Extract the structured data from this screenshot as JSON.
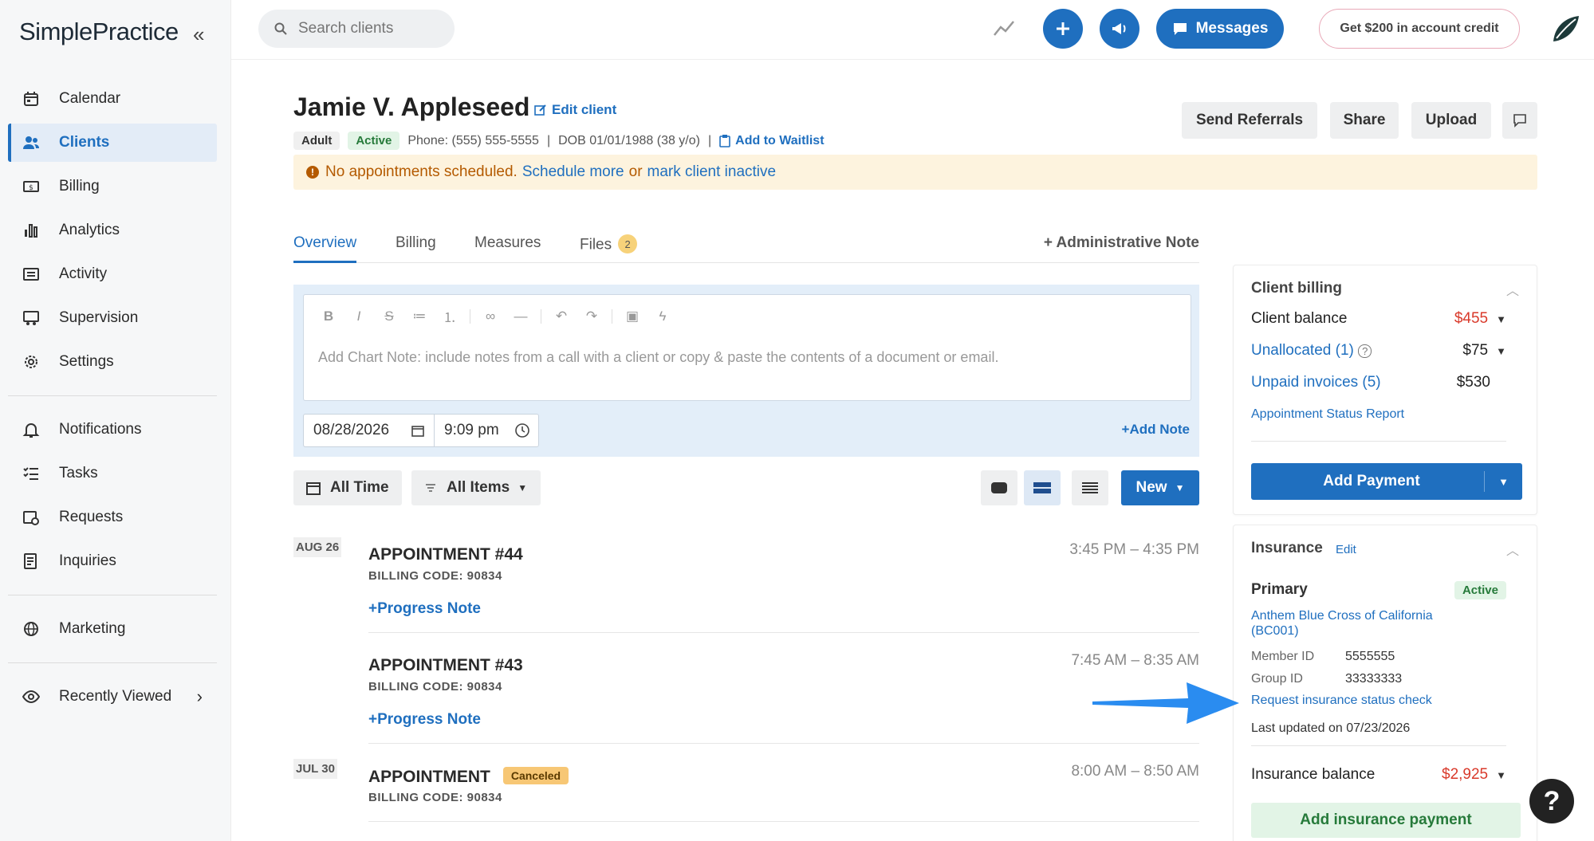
{
  "sidebar": {
    "logo": "SimplePractice",
    "collapse_glyph": "«",
    "items": [
      {
        "label": "Calendar",
        "icon": "calendar-icon"
      },
      {
        "label": "Clients",
        "icon": "users-icon",
        "active": true
      },
      {
        "label": "Billing",
        "icon": "billing-icon"
      },
      {
        "label": "Analytics",
        "icon": "analytics-icon"
      },
      {
        "label": "Activity",
        "icon": "activity-icon"
      },
      {
        "label": "Supervision",
        "icon": "supervision-icon"
      },
      {
        "label": "Settings",
        "icon": "gear-icon"
      }
    ],
    "items2": [
      {
        "label": "Notifications",
        "icon": "bell-icon"
      },
      {
        "label": "Tasks",
        "icon": "tasks-icon"
      },
      {
        "label": "Requests",
        "icon": "requests-icon"
      },
      {
        "label": "Inquiries",
        "icon": "inquiries-icon"
      }
    ],
    "marketing": "Marketing",
    "recently_viewed": "Recently Viewed"
  },
  "topbar": {
    "search_placeholder": "Search clients",
    "messages_label": "Messages",
    "credit_label": "Get $200 in account credit"
  },
  "client": {
    "name": "Jamie V. Appleseed",
    "edit_label": "Edit client",
    "tag_adult": "Adult",
    "tag_active": "Active",
    "phone": "Phone: (555) 555-5555",
    "dob": "DOB 01/01/1988 (38 y/o)",
    "waitlist_label": "Add to Waitlist",
    "separator": "|"
  },
  "header_buttons": {
    "send_referrals": "Send Referrals",
    "share": "Share",
    "upload": "Upload"
  },
  "banner": {
    "text": "No appointments scheduled.",
    "schedule_link": "Schedule more",
    "or": "or",
    "inactive_link": "mark client inactive"
  },
  "tabs": [
    {
      "label": "Overview",
      "active": true
    },
    {
      "label": "Billing"
    },
    {
      "label": "Measures"
    },
    {
      "label": "Files",
      "badge": "2"
    }
  ],
  "admin_note": "Administrative Note",
  "editor": {
    "placeholder": "Add Chart Note: include notes from a call with a client or copy & paste the contents of a document or email.",
    "date": "08/28/2026",
    "time": "9:09 pm",
    "add_note": "Add Note"
  },
  "filters": {
    "all_time": "All Time",
    "all_items": "All Items",
    "new": "New"
  },
  "appointments": [
    {
      "date": "AUG 26",
      "title": "APPOINTMENT #44",
      "code": "BILLING CODE: 90834",
      "time": "3:45 PM – 4:35 PM",
      "action": "Progress Note"
    },
    {
      "date": "",
      "title": "APPOINTMENT #43",
      "code": "BILLING CODE: 90834",
      "time": "7:45 AM – 8:35 AM",
      "action": "Progress Note"
    },
    {
      "date": "JUL 30",
      "title": "APPOINTMENT",
      "status": "Canceled",
      "code": "BILLING CODE: 90834",
      "time": "8:00 AM – 8:50 AM"
    }
  ],
  "client_billing": {
    "title": "Client billing",
    "balance_label": "Client balance",
    "balance_value": "$455",
    "unallocated_label": "Unallocated (1)",
    "unallocated_value": "$75",
    "unpaid_label": "Unpaid invoices (5)",
    "unpaid_value": "$530",
    "report_link": "Appointment Status Report",
    "add_payment": "Add Payment"
  },
  "insurance": {
    "title": "Insurance",
    "edit": "Edit",
    "primary": "Primary",
    "status": "Active",
    "carrier": "Anthem Blue Cross of California (BC001)",
    "member_id_label": "Member ID",
    "member_id": "5555555",
    "group_id_label": "Group ID",
    "group_id": "33333333",
    "request_link": "Request insurance status check",
    "last_updated": "Last updated on 07/23/2026",
    "balance_label": "Insurance balance",
    "balance_value": "$2,925",
    "add_payment": "Add insurance payment"
  },
  "help_glyph": "?",
  "colors": {
    "accent": "#1f6fbf",
    "danger": "#d93a2b",
    "warning_bg": "#fdf3de",
    "success_bg": "#e2f4e6",
    "annotation_arrow": "#2a8cf0"
  }
}
